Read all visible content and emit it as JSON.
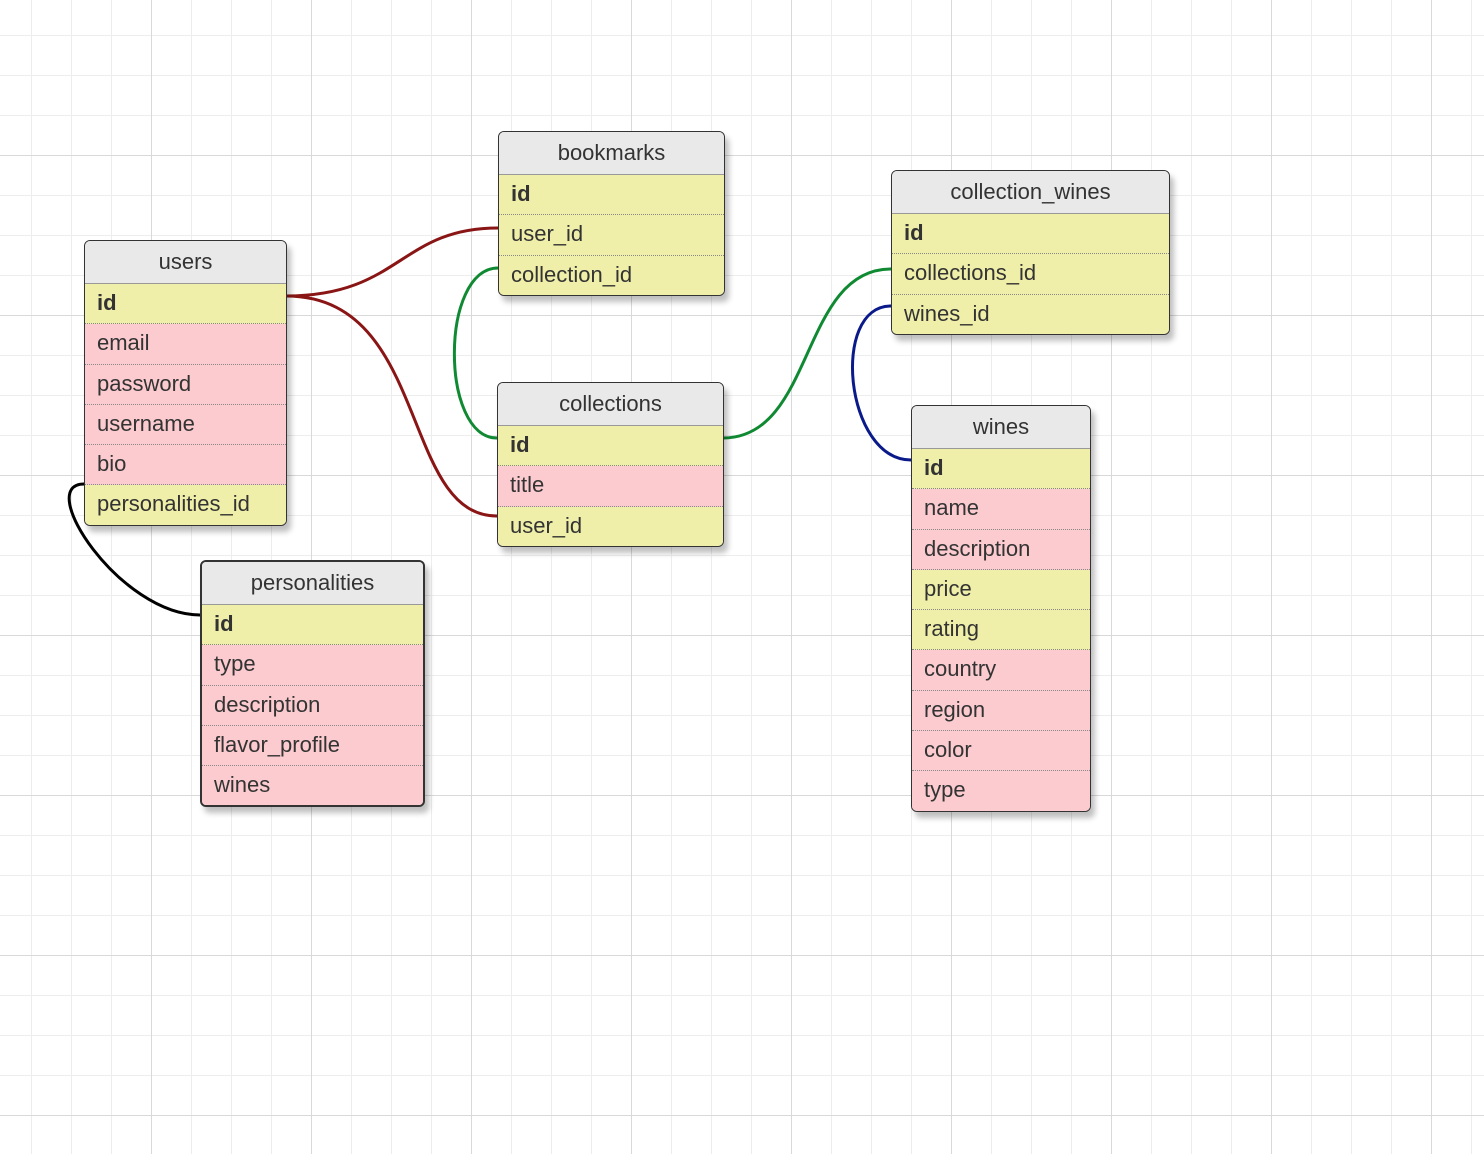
{
  "colors": {
    "grid_minor": "#ededed",
    "grid_major": "#d9d9d9",
    "header_bg": "#e9e9e9",
    "pk_bg": "#efefa9",
    "fk_bg": "#efefa9",
    "attr_bg": "#fbcbcf",
    "shadow": "rgba(0,0,0,.25)",
    "conn_red": "#8a1515",
    "conn_green": "#108a32",
    "conn_blue": "#0a1a8a",
    "conn_black": "#000000"
  },
  "entities": {
    "users": {
      "title": "users",
      "rows": [
        {
          "label": "id",
          "kind": "pk"
        },
        {
          "label": "email",
          "kind": "attr"
        },
        {
          "label": "password",
          "kind": "attr"
        },
        {
          "label": "username",
          "kind": "attr"
        },
        {
          "label": "bio",
          "kind": "attr"
        },
        {
          "label": "personalities_id",
          "kind": "fk"
        }
      ]
    },
    "personalities": {
      "title": "personalities",
      "rows": [
        {
          "label": "id",
          "kind": "pk"
        },
        {
          "label": "type",
          "kind": "attr"
        },
        {
          "label": "description",
          "kind": "attr"
        },
        {
          "label": "flavor_profile",
          "kind": "attr"
        },
        {
          "label": "wines",
          "kind": "attr"
        }
      ]
    },
    "bookmarks": {
      "title": "bookmarks",
      "rows": [
        {
          "label": "id",
          "kind": "pk"
        },
        {
          "label": "user_id",
          "kind": "fk"
        },
        {
          "label": "collection_id",
          "kind": "fk"
        }
      ]
    },
    "collections": {
      "title": "collections",
      "rows": [
        {
          "label": "id",
          "kind": "pk"
        },
        {
          "label": "title",
          "kind": "attr"
        },
        {
          "label": "user_id",
          "kind": "fk"
        }
      ]
    },
    "collection_wines": {
      "title": "collection_wines",
      "rows": [
        {
          "label": "id",
          "kind": "pk"
        },
        {
          "label": "collections_id",
          "kind": "fk"
        },
        {
          "label": "wines_id",
          "kind": "fk"
        }
      ]
    },
    "wines": {
      "title": "wines",
      "rows": [
        {
          "label": "id",
          "kind": "pk"
        },
        {
          "label": "name",
          "kind": "attr"
        },
        {
          "label": "description",
          "kind": "attr"
        },
        {
          "label": "price",
          "kind": "fk"
        },
        {
          "label": "rating",
          "kind": "fk"
        },
        {
          "label": "country",
          "kind": "attr"
        },
        {
          "label": "region",
          "kind": "attr"
        },
        {
          "label": "color",
          "kind": "attr"
        },
        {
          "label": "type",
          "kind": "attr"
        }
      ]
    }
  },
  "connectors": [
    {
      "name": "users-id_to_bookmarks-user_id",
      "color": "conn_red"
    },
    {
      "name": "users-id_to_collections-user_id",
      "color": "conn_red"
    },
    {
      "name": "bookmarks-collection_id_to_collections-id",
      "color": "conn_green"
    },
    {
      "name": "collections-id_to_collection_wines-collections_id",
      "color": "conn_green"
    },
    {
      "name": "collection_wines-wines_id_to_wines-id",
      "color": "conn_blue"
    },
    {
      "name": "users-personalities_id_to_personalities-id",
      "color": "conn_black"
    }
  ]
}
